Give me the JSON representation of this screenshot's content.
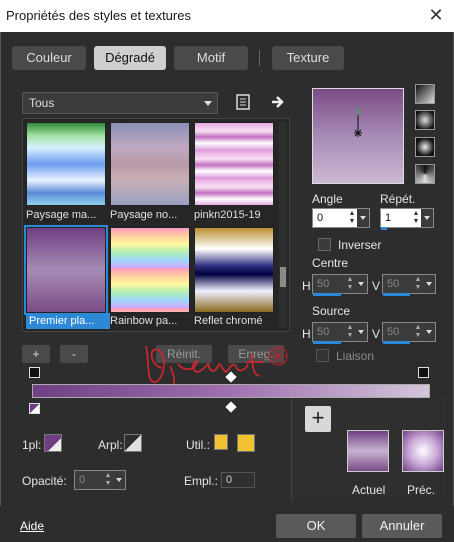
{
  "window": {
    "title": "Propriétés des styles et textures"
  },
  "tabs": [
    {
      "label": "Couleur"
    },
    {
      "label": "Dégradé"
    },
    {
      "label": "Motif"
    },
    {
      "label": "Texture"
    }
  ],
  "category": {
    "selected": "Tous"
  },
  "gradients": [
    {
      "name": "Paysage ma..."
    },
    {
      "name": "Paysage no..."
    },
    {
      "name": "pinkn2015-19"
    },
    {
      "name": "Premier pla..."
    },
    {
      "name": "Rainbow pa..."
    },
    {
      "name": "Reflet chromé"
    }
  ],
  "library_buttons": {
    "add": "+",
    "remove": "-",
    "reset": "Réinit.",
    "save": "Enreg."
  },
  "controls": {
    "angle_label": "Angle",
    "angle_value": "0",
    "repeat_label": "Répét.",
    "repeat_value": "1",
    "invert_label": "Inverser",
    "center_label": "Centre",
    "center_h": "50",
    "center_v": "50",
    "source_label": "Source",
    "source_h": "50",
    "source_v": "50",
    "link_label": "Liaison",
    "h": "H",
    "v": "V"
  },
  "stops": {
    "fg_label": "1pl:",
    "bg_label": "Arpl:",
    "user_label": "Util.:",
    "opacity_label": "Opacité:",
    "opacity_value": "0",
    "location_label": "Empl.:",
    "location_value": "0"
  },
  "right_panel": {
    "current_label": "Actuel",
    "previous_label": "Préc."
  },
  "footer": {
    "help": "Aide",
    "ok": "OK",
    "cancel": "Annuler"
  },
  "watermark": {
    "text": "Bijounet"
  },
  "colors": {
    "accent": "#2d89d6",
    "gradient_dark": "#6e3f82",
    "gradient_light": "#d3c6da",
    "user_color": "#f1c232"
  }
}
